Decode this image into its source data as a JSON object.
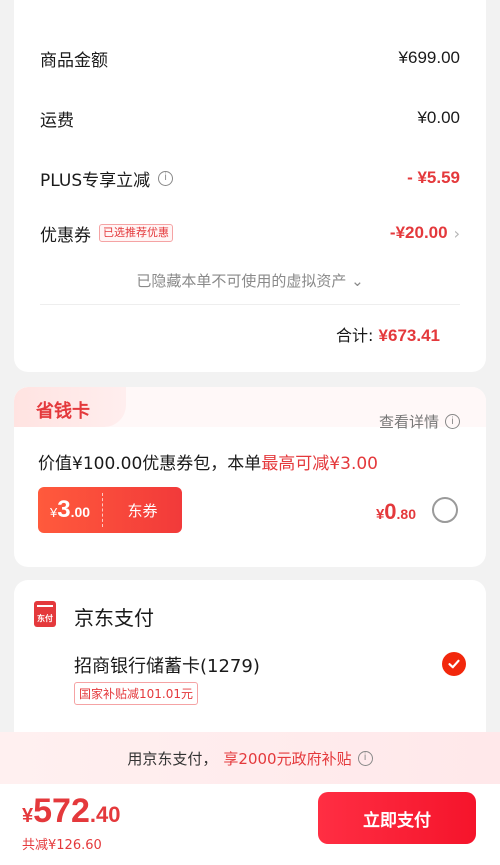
{
  "fees": {
    "product_amount": {
      "label": "商品金额",
      "value": "¥699.00"
    },
    "shipping": {
      "label": "运费",
      "value": "¥0.00"
    },
    "plus_discount": {
      "label": "PLUS专享立减",
      "value": "- ¥5.59"
    },
    "coupon": {
      "label": "优惠券",
      "tag": "已选推荐优惠",
      "value": "-¥20.00",
      "chevron": "›"
    },
    "hidden_assets": "已隐藏本单不可使用的虚拟资产",
    "hidden_assets_chevron": "⌄",
    "total_label": "合计:",
    "total_value": "¥673.41"
  },
  "savings_card": {
    "title": "省钱卡",
    "details_link": "查看详情",
    "desc_prefix": "价值¥100.00优惠券包，本单",
    "desc_highlight": "最高可减¥3.00",
    "coupon_symbol": "¥",
    "coupon_int": "3",
    "coupon_dec": ".00",
    "coupon_name": "东券",
    "price_symbol": "¥",
    "price_int": "0",
    "price_dec": ".80",
    "selected": false
  },
  "payment": {
    "icon_text": "东付",
    "method_title": "京东支付",
    "bank_card": "招商银行储蓄卡(1279)",
    "subsidy_tag": "国家补贴减101.01元",
    "selected": true
  },
  "promo": {
    "prefix": "用京东支付，",
    "highlight": "享2000元政府补贴"
  },
  "bottom": {
    "amount_symbol": "¥",
    "amount_int": "572",
    "amount_dec": ".40",
    "total_discount": "共减¥126.60",
    "pay_button": "立即支付"
  },
  "colors": {
    "accent": "#e4393c",
    "pay_button": "#f5142b",
    "background": "#f2f2f2"
  }
}
